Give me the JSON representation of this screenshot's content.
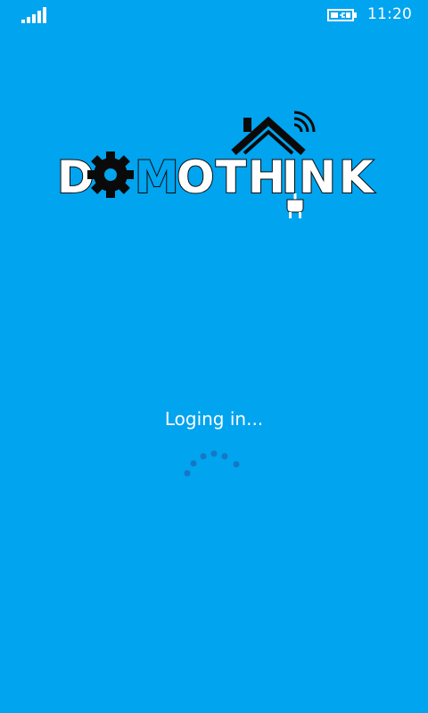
{
  "status_bar": {
    "time": "11:20",
    "signal_icon": "signal-strength-icon",
    "battery_icon": "battery-charging-icon"
  },
  "logo": {
    "text": "DOMOTHINK",
    "icons": [
      "gear-icon",
      "house-icon",
      "wifi-icon",
      "plug-icon"
    ]
  },
  "loading": {
    "message": "Loging in...",
    "spinner_icon": "progress-dots-icon"
  },
  "colors": {
    "background": "#01a4ef",
    "text": "#ffffff",
    "spinner_dot": "#1677c4",
    "logo_dark": "#0a0a0a"
  }
}
